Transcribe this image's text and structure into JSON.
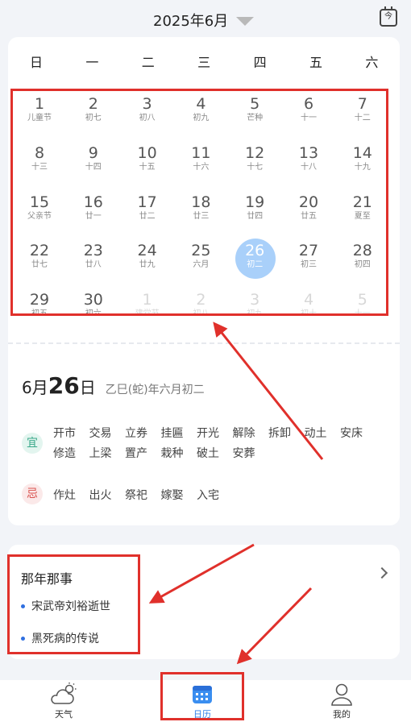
{
  "header": {
    "month_title": "2025年6月",
    "today_icon_label": "今"
  },
  "weekdays": [
    "日",
    "一",
    "二",
    "三",
    "四",
    "五",
    "六"
  ],
  "calendar": {
    "today_index": 25,
    "days": [
      {
        "n": "1",
        "s": "儿童节"
      },
      {
        "n": "2",
        "s": "初七"
      },
      {
        "n": "3",
        "s": "初八"
      },
      {
        "n": "4",
        "s": "初九"
      },
      {
        "n": "5",
        "s": "芒种"
      },
      {
        "n": "6",
        "s": "十一"
      },
      {
        "n": "7",
        "s": "十二"
      },
      {
        "n": "8",
        "s": "十三"
      },
      {
        "n": "9",
        "s": "十四"
      },
      {
        "n": "10",
        "s": "十五"
      },
      {
        "n": "11",
        "s": "十六"
      },
      {
        "n": "12",
        "s": "十七"
      },
      {
        "n": "13",
        "s": "十八"
      },
      {
        "n": "14",
        "s": "十九"
      },
      {
        "n": "15",
        "s": "父亲节"
      },
      {
        "n": "16",
        "s": "廿一"
      },
      {
        "n": "17",
        "s": "廿二"
      },
      {
        "n": "18",
        "s": "廿三"
      },
      {
        "n": "19",
        "s": "廿四"
      },
      {
        "n": "20",
        "s": "廿五"
      },
      {
        "n": "21",
        "s": "夏至"
      },
      {
        "n": "22",
        "s": "廿七"
      },
      {
        "n": "23",
        "s": "廿八"
      },
      {
        "n": "24",
        "s": "廿九"
      },
      {
        "n": "25",
        "s": "六月"
      },
      {
        "n": "26",
        "s": "初二"
      },
      {
        "n": "27",
        "s": "初三"
      },
      {
        "n": "28",
        "s": "初四"
      },
      {
        "n": "29",
        "s": "初五"
      },
      {
        "n": "30",
        "s": "初六"
      },
      {
        "n": "1",
        "s": "建党节",
        "faded": true
      },
      {
        "n": "2",
        "s": "初八",
        "faded": true
      },
      {
        "n": "3",
        "s": "初九",
        "faded": true
      },
      {
        "n": "4",
        "s": "初十",
        "faded": true
      },
      {
        "n": "5",
        "s": "十一",
        "faded": true
      }
    ]
  },
  "detail": {
    "month": "6月",
    "day": "26",
    "day_suffix": "日",
    "lunar": "乙巳(蛇)年六月初二",
    "yi_label": "宜",
    "yi_items": [
      "开市",
      "交易",
      "立券",
      "挂匾",
      "开光",
      "解除",
      "拆卸",
      "动土",
      "安床",
      "修造",
      "上梁",
      "置产",
      "栽种",
      "破土",
      "安葬"
    ],
    "ji_label": "忌",
    "ji_items": [
      "作灶",
      "出火",
      "祭祀",
      "嫁娶",
      "入宅"
    ]
  },
  "events": {
    "title": "那年那事",
    "items": [
      "宋武帝刘裕逝世",
      "黑死病的传说"
    ]
  },
  "tabs": [
    {
      "label": "天气",
      "icon": "cloud-sun-icon"
    },
    {
      "label": "日历",
      "icon": "calendar-icon",
      "active": true
    },
    {
      "label": "我的",
      "icon": "user-icon"
    }
  ],
  "colors": {
    "annotation_red": "#e0302b",
    "today_circle": "#a9d0fa",
    "accent_blue": "#2f7fe8",
    "yi_green": "#39a889",
    "ji_red": "#d9534f"
  }
}
